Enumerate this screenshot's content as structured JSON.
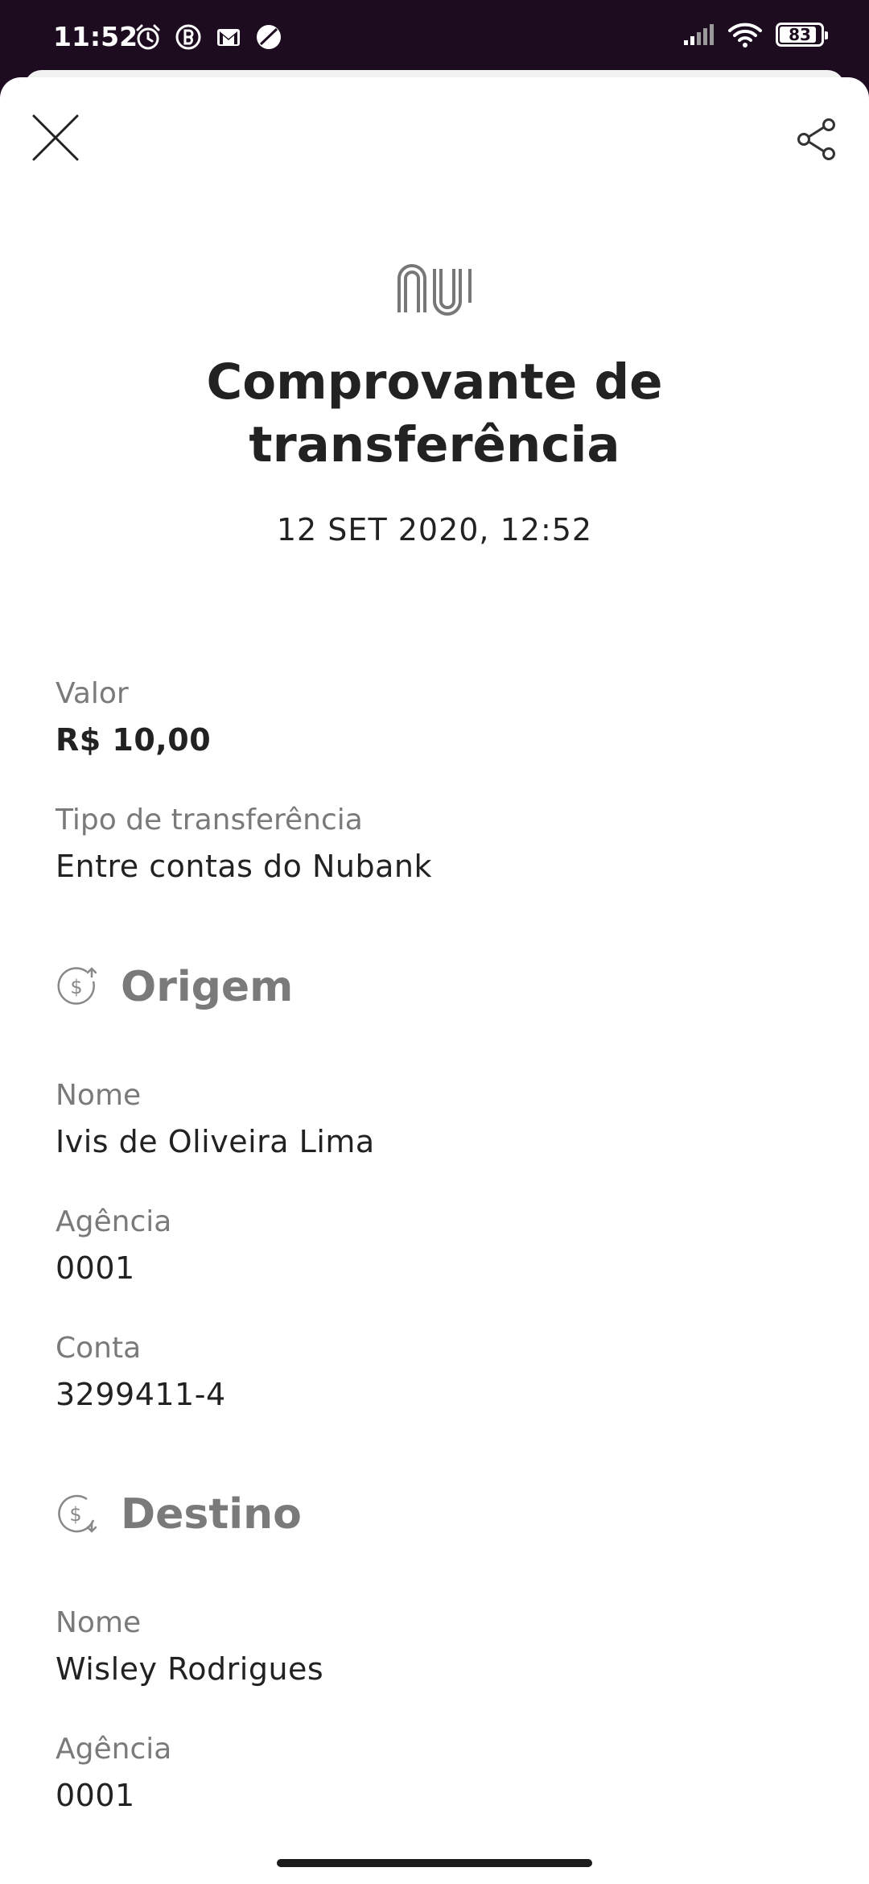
{
  "status_bar": {
    "time": "11:52",
    "battery": "83",
    "battery_level": 0.83,
    "icons": [
      "alarm-icon",
      "b-icon",
      "gmail-icon",
      "moon-icon",
      "signal-icon",
      "wifi-icon",
      "battery-icon"
    ]
  },
  "header": {
    "title_line1": "Comprovante de",
    "title_line2": "transferência",
    "datetime": "12 SET 2020, 12:52"
  },
  "details": {
    "valor": {
      "label": "Valor",
      "value": "R$ 10,00"
    },
    "tipo": {
      "label": "Tipo de transferência",
      "value": "Entre contas do Nubank"
    }
  },
  "origem": {
    "title": "Origem",
    "nome": {
      "label": "Nome",
      "value": "Ivis de Oliveira Lima"
    },
    "agencia": {
      "label": "Agência",
      "value": "0001"
    },
    "conta": {
      "label": "Conta",
      "value": "3299411-4"
    }
  },
  "destino": {
    "title": "Destino",
    "nome": {
      "label": "Nome",
      "value": "Wisley Rodrigues"
    },
    "agencia": {
      "label": "Agência",
      "value": "0001"
    }
  },
  "colors": {
    "status_bar_bg": "#1d0c20",
    "text_primary": "#222222",
    "text_secondary": "#7a7a7a"
  }
}
